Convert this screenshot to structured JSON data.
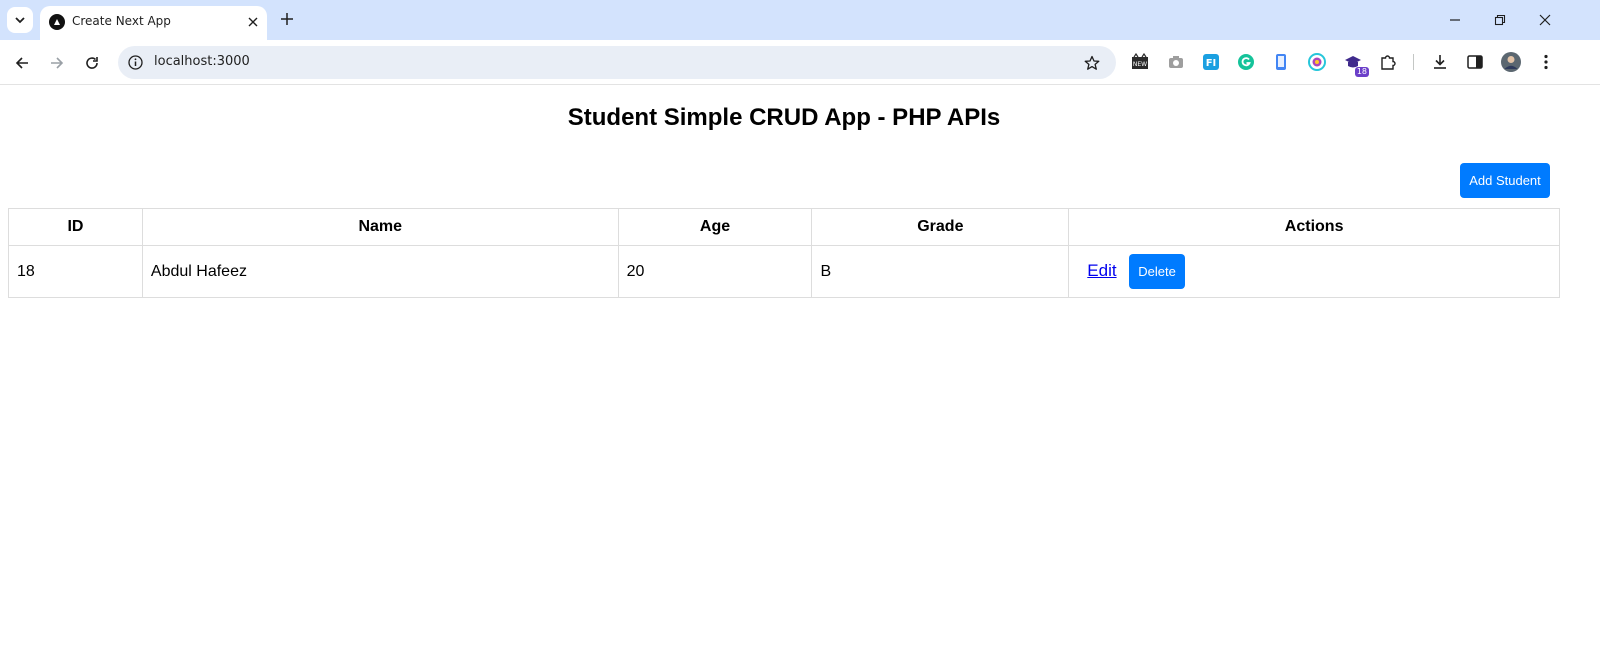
{
  "browser": {
    "tab_title": "Create Next App",
    "url": "localhost:3000",
    "icons": {
      "tab_search": "chevron-down-icon",
      "favicon": "nextjs-logo-icon",
      "tab_close": "close-icon",
      "new_tab": "plus-icon",
      "back": "arrow-left-icon",
      "forward": "arrow-right-icon",
      "reload": "reload-icon",
      "site_info": "info-icon",
      "bookmark": "star-icon"
    },
    "extensions": [
      {
        "name": "news-extension-icon",
        "label": "NEW"
      },
      {
        "name": "camera-extension-icon",
        "label": ""
      },
      {
        "name": "fi-extension-icon",
        "label": "FI"
      },
      {
        "name": "grammarly-extension-icon",
        "label": ""
      },
      {
        "name": "phone-extension-icon",
        "label": ""
      },
      {
        "name": "color-extension-icon",
        "label": ""
      },
      {
        "name": "graduation-extension-icon",
        "badge": "18"
      }
    ]
  },
  "app": {
    "title": "Student Simple CRUD App - PHP APIs",
    "add_button": "Add Student",
    "table": {
      "headers": [
        "ID",
        "Name",
        "Age",
        "Grade",
        "Actions"
      ],
      "rows": [
        {
          "id": "18",
          "name": "Abdul Hafeez",
          "age": "20",
          "grade": "B",
          "edit": "Edit",
          "delete": "Delete"
        }
      ]
    }
  },
  "colors": {
    "primary_button": "#007bff",
    "tab_strip": "#d3e3fd",
    "omnibox": "#e9eef6",
    "link": "#0000ee"
  }
}
